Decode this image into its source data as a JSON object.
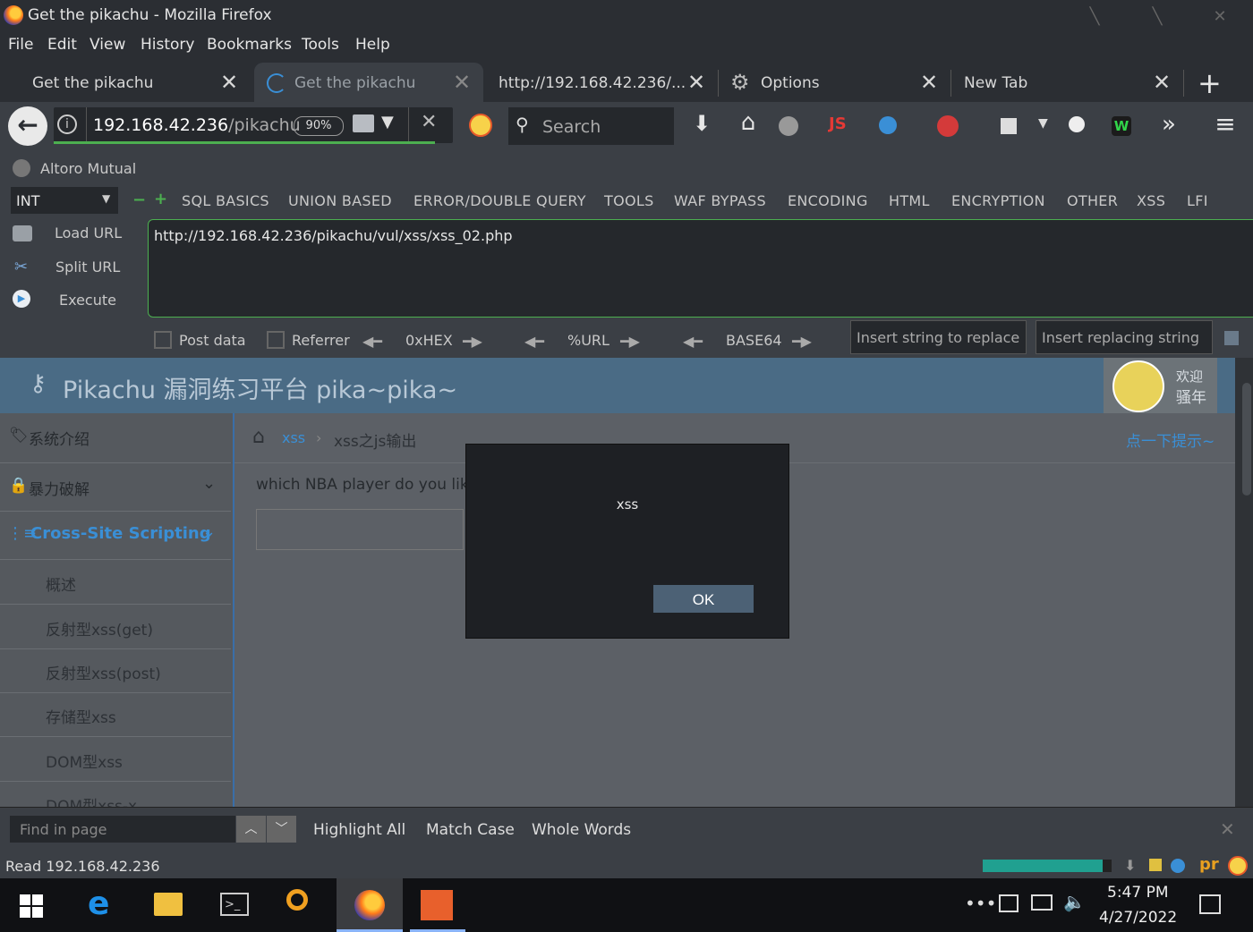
{
  "window": {
    "title": "Get the pikachu - Mozilla Firefox"
  },
  "menu": [
    "File",
    "Edit",
    "View",
    "History",
    "Bookmarks",
    "Tools",
    "Help"
  ],
  "tabs": [
    {
      "label": "Get the pikachu"
    },
    {
      "label": "Get the pikachu"
    },
    {
      "label": "http://192.168.42.236/..."
    },
    {
      "label": "Options"
    },
    {
      "label": "New Tab"
    }
  ],
  "nav": {
    "url_host": "192.168.42.236",
    "url_path": "/pikachu",
    "zoom": "90%",
    "search_placeholder": "Search"
  },
  "bookmarks": [
    {
      "label": "Altoro Mutual"
    }
  ],
  "hackbar": {
    "type_select": "INT",
    "menus": [
      "SQL BASICS",
      "UNION BASED",
      "ERROR/DOUBLE QUERY",
      "TOOLS",
      "WAF BYPASS",
      "ENCODING",
      "HTML",
      "ENCRYPTION",
      "OTHER",
      "XSS",
      "LFI"
    ],
    "load_url": "Load URL",
    "split_url": "Split URL",
    "execute": "Execute",
    "url_value": "http://192.168.42.236/pikachu/vul/xss/xss_02.php",
    "post_data": "Post data",
    "referrer": "Referrer",
    "hex": "0xHEX",
    "urlenc": "%URL",
    "base64": "BASE64",
    "replace_placeholder": "Insert string to replace",
    "replacing_placeholder": "Insert replacing string"
  },
  "page": {
    "title": "Pikachu 漏洞练习平台 pika~pika~",
    "welcome_line1": "欢迎",
    "welcome_line2": "骚年",
    "sidebar": [
      {
        "label": "系统介绍",
        "type": "top"
      },
      {
        "label": "暴力破解",
        "type": "top"
      },
      {
        "label": "Cross-Site Scripting",
        "type": "active"
      },
      {
        "label": "概述",
        "type": "sub"
      },
      {
        "label": "反射型xss(get)",
        "type": "sub"
      },
      {
        "label": "反射型xss(post)",
        "type": "sub"
      },
      {
        "label": "存储型xss",
        "type": "sub"
      },
      {
        "label": "DOM型xss",
        "type": "sub"
      },
      {
        "label": "DOM型xss-x",
        "type": "sub"
      }
    ],
    "breadcrumb_link": "xss",
    "breadcrumb_sep": "›",
    "breadcrumb_current": "xss之js输出",
    "hint": "点一下提示~",
    "question": "which NBA player do you lik"
  },
  "modal": {
    "message": "xss",
    "ok": "OK"
  },
  "findbar": {
    "placeholder": "Find in page",
    "highlight_all": "Highlight All",
    "match_case": "Match Case",
    "whole_words": "Whole Words"
  },
  "status": {
    "text": "Read 192.168.42.236",
    "progress": 0.93
  },
  "taskbar": {
    "time": "5:47 PM",
    "date": "4/27/2022"
  },
  "colors": {
    "accent": "#4caf50",
    "link": "#3a8fd6",
    "page_header": "#4a6b85"
  }
}
